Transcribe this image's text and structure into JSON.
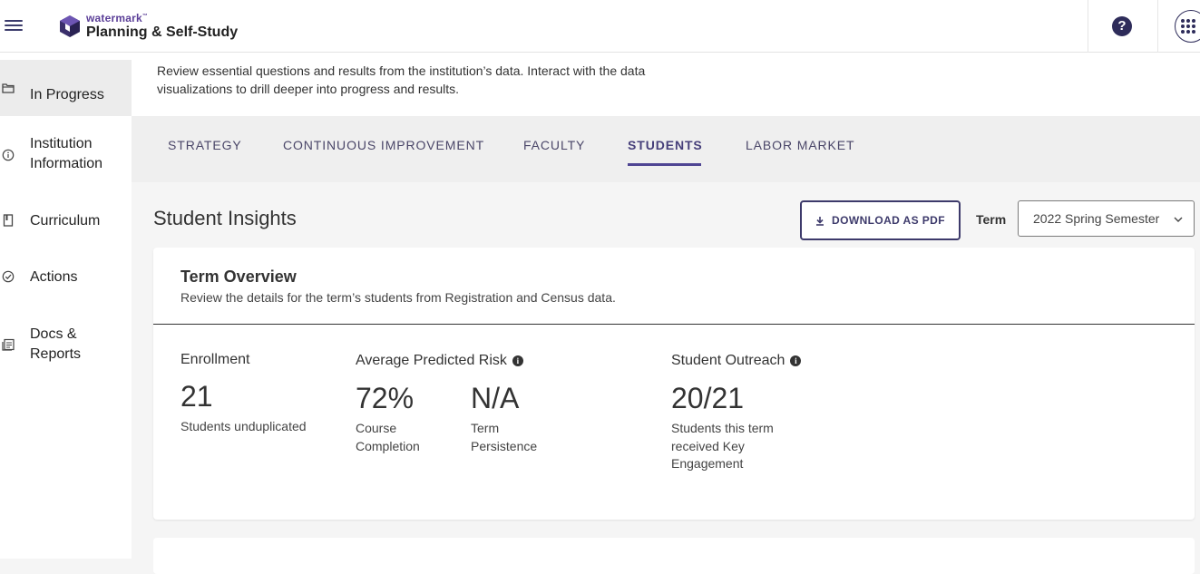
{
  "header": {
    "brand": "watermark",
    "brand_tm": "™",
    "product": "Planning & Self-Study",
    "help_label": "?"
  },
  "sidebar": {
    "items": [
      {
        "label": "In Progress",
        "icon": "folder-icon",
        "active": true
      },
      {
        "label": "Institution Information",
        "icon": "info-icon",
        "active": false
      },
      {
        "label": "Curriculum",
        "icon": "book-icon",
        "active": false
      },
      {
        "label": "Actions",
        "icon": "check-circle-icon",
        "active": false
      },
      {
        "label": "Docs & Reports",
        "icon": "document-stack-icon",
        "active": false
      }
    ]
  },
  "intro": {
    "text": "Review essential questions and results from the institution’s data. Interact with the data visualizations to drill deeper into progress and results."
  },
  "tabs": [
    {
      "label": "STRATEGY",
      "active": false
    },
    {
      "label": "CONTINUOUS IMPROVEMENT",
      "active": false
    },
    {
      "label": "FACULTY",
      "active": false
    },
    {
      "label": "STUDENTS",
      "active": true
    },
    {
      "label": "LABOR MARKET",
      "active": false
    }
  ],
  "section": {
    "title": "Student Insights",
    "download_label": "DOWNLOAD AS PDF",
    "term_label": "Term",
    "term_value": "2022 Spring Semester"
  },
  "term_overview": {
    "title": "Term Overview",
    "subtitle": "Review the details for the term’s students from Registration and Census data.",
    "enrollment": {
      "heading": "Enrollment",
      "value": "21",
      "caption": "Students unduplicated"
    },
    "risk": {
      "heading": "Average Predicted Risk",
      "course_completion": {
        "value": "72%",
        "caption": "Course Completion"
      },
      "term_persistence": {
        "value": "N/A",
        "caption": "Term Persistence"
      }
    },
    "outreach": {
      "heading": "Student Outreach",
      "value": "20/21",
      "caption": "Students this term received Key Engagement"
    }
  },
  "colors": {
    "accent": "#4f4593",
    "brand_purple": "#5b3f98",
    "dark_navy": "#2e2c5a"
  }
}
